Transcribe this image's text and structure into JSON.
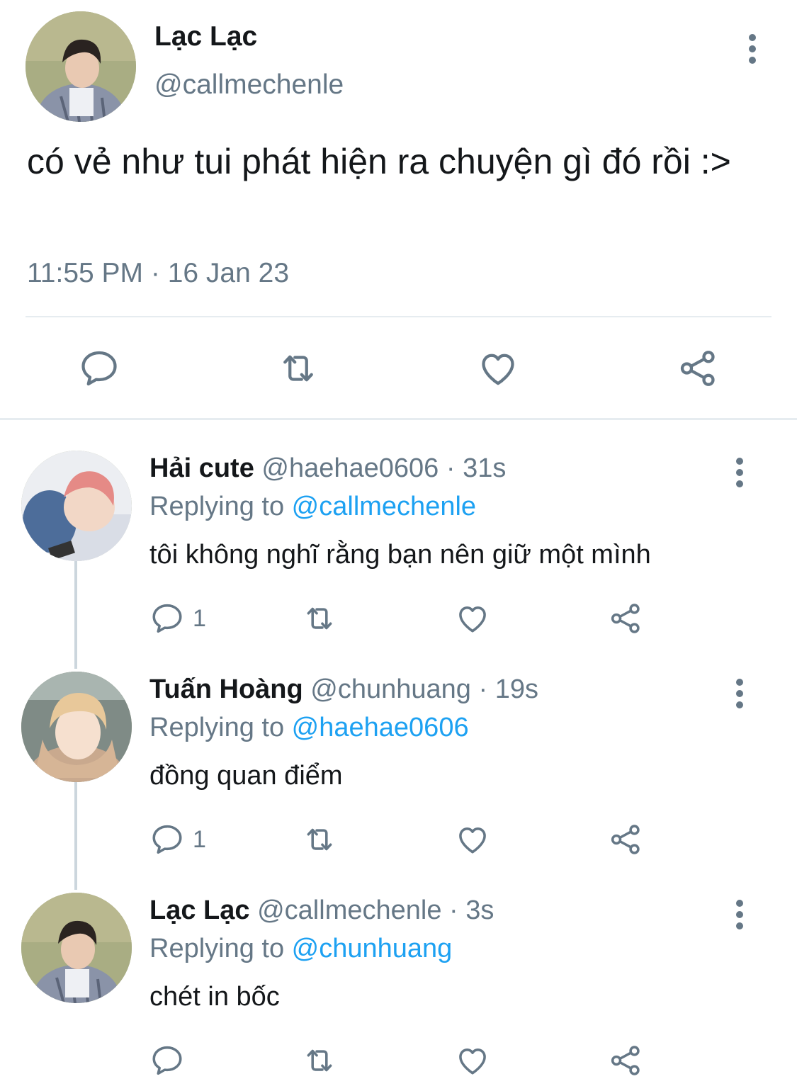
{
  "main_tweet": {
    "author_name": "Lạc Lạc",
    "author_handle": "@callmechenle",
    "text": "có vẻ như tui phát hiện ra chuyện gì đó rồi :>",
    "timestamp": "11:55 PM · 16 Jan 23",
    "actions": [
      "reply-icon",
      "retweet-icon",
      "like-icon",
      "share-icon"
    ]
  },
  "replies": [
    {
      "name": "Hải cute",
      "handle": "@haehae0606",
      "time": "31s",
      "replying_prefix": "Replying to ",
      "replying_to": "@callmechenle",
      "text": "tôi không nghĩ rằng bạn nên giữ một mình",
      "reply_count": "1"
    },
    {
      "name": "Tuấn Hoàng",
      "handle": "@chunhuang",
      "time": "19s",
      "replying_prefix": "Replying to ",
      "replying_to": "@haehae0606",
      "text": "đồng quan điểm",
      "reply_count": "1"
    },
    {
      "name": "Lạc Lạc",
      "handle": "@callmechenle",
      "time": "3s",
      "replying_prefix": "Replying to ",
      "replying_to": "@chunhuang",
      "text": "chét in bốc",
      "reply_count": ""
    }
  ],
  "colors": {
    "text": "#14171a",
    "secondary": "#657786",
    "mention": "#1da1f2",
    "divider": "#e6ecf0",
    "thread_line": "#ccd6dd"
  }
}
